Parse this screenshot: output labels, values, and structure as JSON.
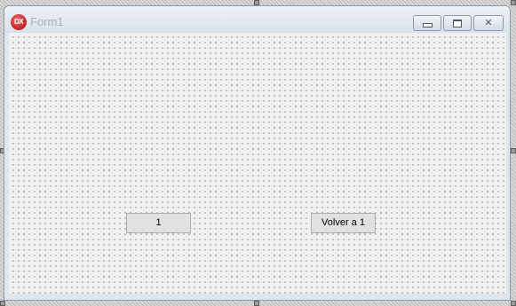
{
  "window": {
    "title": "Form1",
    "icon": "devexpress-logo-icon",
    "icon_text": "DX",
    "accent_color": "#c02222",
    "controls": {
      "minimize": "minimize-icon",
      "maximize": "maximize-icon",
      "close": "close-icon",
      "close_glyph": "✕"
    }
  },
  "form": {
    "buttons": [
      {
        "label": "1"
      },
      {
        "label": "Volver a 1"
      }
    ]
  }
}
